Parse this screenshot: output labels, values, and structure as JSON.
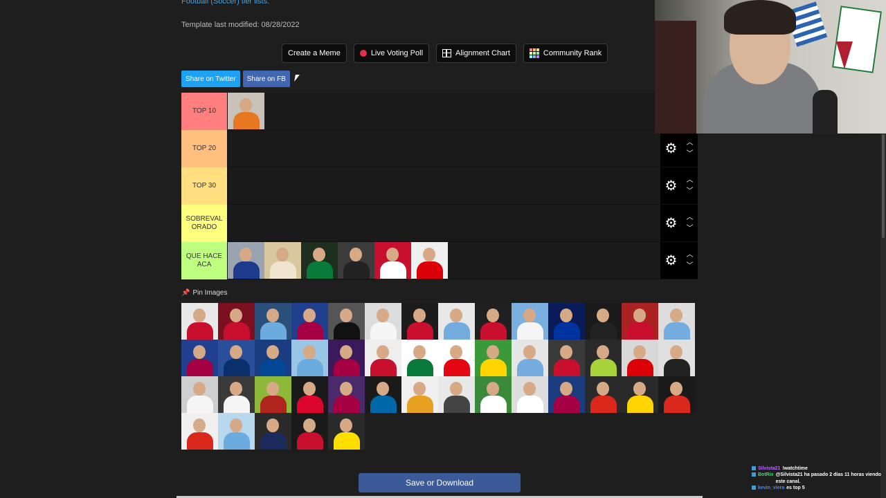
{
  "header": {
    "top_link": "Football (Soccer) tier lists.",
    "template_modified": "Template last modified: 08/28/2022"
  },
  "actions": {
    "create_meme": "Create a Meme",
    "live_voting": "Live Voting Poll",
    "alignment_chart": "Alignment Chart",
    "community_rank": "Community Rank"
  },
  "share": {
    "twitter": "Share on Twitter",
    "facebook": "Share on FB"
  },
  "tiers": [
    {
      "label": "TOP 10",
      "color": "#ff7f7f",
      "items": [
        {
          "shirt": "#e87722",
          "bg": "#c9c2b8"
        }
      ]
    },
    {
      "label": "TOP 20",
      "color": "#ffbf7f",
      "items": []
    },
    {
      "label": "TOP 30",
      "color": "#ffdf7f",
      "items": []
    },
    {
      "label": "SOBREVALORADO",
      "color": "#ffff7f",
      "items": []
    },
    {
      "label": "QUE HACE ACA",
      "color": "#bfff7f",
      "items": [
        {
          "shirt": "#1e3a8a",
          "bg": "#9aa4b0"
        },
        {
          "shirt": "#f0e4d0",
          "bg": "#d9c7a0"
        },
        {
          "shirt": "#0a7a3a",
          "bg": "#1f2f1f"
        },
        {
          "shirt": "#222222",
          "bg": "#3b3b3b"
        },
        {
          "shirt": "#ffffff",
          "bg": "#c8102e"
        },
        {
          "shirt": "#db0007",
          "bg": "#f0f0f0"
        }
      ]
    }
  ],
  "pin_images": {
    "label": "Pin Images",
    "items": [
      {
        "shirt": "#c8102e",
        "bg": "#e8e8e8"
      },
      {
        "shirt": "#c8102e",
        "bg": "#7a1020"
      },
      {
        "shirt": "#6cabdd",
        "bg": "#2a4f7a"
      },
      {
        "shirt": "#a50044",
        "bg": "#203f8f"
      },
      {
        "shirt": "#111111",
        "bg": "#555555"
      },
      {
        "shirt": "#f5f5f5",
        "bg": "#dcdcdc"
      },
      {
        "shirt": "#c8102e",
        "bg": "#1c1c1c"
      },
      {
        "shirt": "#74acdf",
        "bg": "#e8e8e8"
      },
      {
        "shirt": "#c8102e",
        "bg": "#202020"
      },
      {
        "shirt": "#f5f5f5",
        "bg": "#7ab0e0"
      },
      {
        "shirt": "#0033a0",
        "bg": "#0a1b5a"
      },
      {
        "shirt": "#222222",
        "bg": "#1a1a1a"
      },
      {
        "shirt": "#c8102e",
        "bg": "#aa2222"
      },
      {
        "shirt": "#74acdf",
        "bg": "#dddddd"
      },
      {
        "shirt": "#a50044",
        "bg": "#203f8f"
      },
      {
        "shirt": "#0b2f6b",
        "bg": "#2a4f9a"
      },
      {
        "shirt": "#034694",
        "bg": "#1c3c80"
      },
      {
        "shirt": "#6cabdd",
        "bg": "#9ac6e6"
      },
      {
        "shirt": "#a50044",
        "bg": "#3a1a5a"
      },
      {
        "shirt": "#c8102e",
        "bg": "#eeeeee"
      },
      {
        "shirt": "#0a7a3a",
        "bg": "#ffffff"
      },
      {
        "shirt": "#e30613",
        "bg": "#ffffff"
      },
      {
        "shirt": "#ffd400",
        "bg": "#3a9a3a"
      },
      {
        "shirt": "#74acdf",
        "bg": "#e6e6e6"
      },
      {
        "shirt": "#c8102e",
        "bg": "#3a3a3a"
      },
      {
        "shirt": "#a8d23a",
        "bg": "#2a2a2a"
      },
      {
        "shirt": "#db0007",
        "bg": "#d8d8d8"
      },
      {
        "shirt": "#222222",
        "bg": "#e0e0e0"
      },
      {
        "shirt": "#f5f5f5",
        "bg": "#cfcfcf"
      },
      {
        "shirt": "#f5f5f5",
        "bg": "#3a3a3a"
      },
      {
        "shirt": "#b0241e",
        "bg": "#8db83a"
      },
      {
        "shirt": "#dc052d",
        "bg": "#1a1a1a"
      },
      {
        "shirt": "#a50044",
        "bg": "#4a2a6a"
      },
      {
        "shirt": "#0068a8",
        "bg": "#1a1a1a"
      },
      {
        "shirt": "#e8a020",
        "bg": "#f0f0f0"
      },
      {
        "shirt": "#444444",
        "bg": "#e8e8e8"
      },
      {
        "shirt": "#ffffff",
        "bg": "#3a8a3a"
      },
      {
        "shirt": "#ffffff",
        "bg": "#dddddd"
      },
      {
        "shirt": "#a50044",
        "bg": "#1c3c80"
      },
      {
        "shirt": "#da291c",
        "bg": "#2a2a2a"
      },
      {
        "shirt": "#ffd400",
        "bg": "#2a2a2a"
      },
      {
        "shirt": "#da291c",
        "bg": "#1a1a1a"
      },
      {
        "shirt": "#da291c",
        "bg": "#f0f0f0"
      },
      {
        "shirt": "#6cabdd",
        "bg": "#b8d8ee"
      },
      {
        "shirt": "#1a2a5a",
        "bg": "#2a2a2a"
      },
      {
        "shirt": "#c8102e",
        "bg": "#1a1a1a"
      },
      {
        "shirt": "#ffdf00",
        "bg": "#2a2a2a"
      }
    ]
  },
  "footer": {
    "save_label": "Save or Download"
  },
  "chat": [
    {
      "name": "Silvista21",
      "name_color": "#b36cf0",
      "msg": "!watchtime"
    },
    {
      "name": "BotRix",
      "name_color": "#3bd96b",
      "msg": "@Silvista21 ha pasado 2 días 11 horas viendo este canal."
    },
    {
      "name": "kevin_viera",
      "name_color": "#4a8af0",
      "msg": "es top 5"
    }
  ]
}
